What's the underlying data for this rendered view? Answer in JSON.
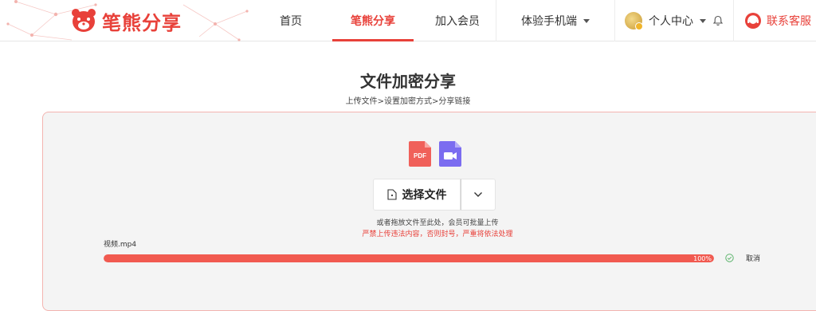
{
  "brand": {
    "name": "笔熊分享",
    "color": "#e8413a"
  },
  "nav": {
    "home": "首页",
    "share": "笔熊分享",
    "vip": "加入会员",
    "mobile": "体验手机端",
    "user": "个人中心",
    "service": "联系客服"
  },
  "page": {
    "title": "文件加密分享",
    "steps": "上传文件>设置加密方式>分享链接"
  },
  "upload": {
    "file_types": [
      "PDF",
      "video"
    ],
    "choose_label": "选择文件",
    "hint": "或者拖放文件至此处，会员可批量上传",
    "warning": "严禁上传违法内容，否则封号，严重将依法处理",
    "file_name": "视频.mp4",
    "progress": 1.0,
    "progress_text": "100%",
    "cancel_label": "取消"
  }
}
